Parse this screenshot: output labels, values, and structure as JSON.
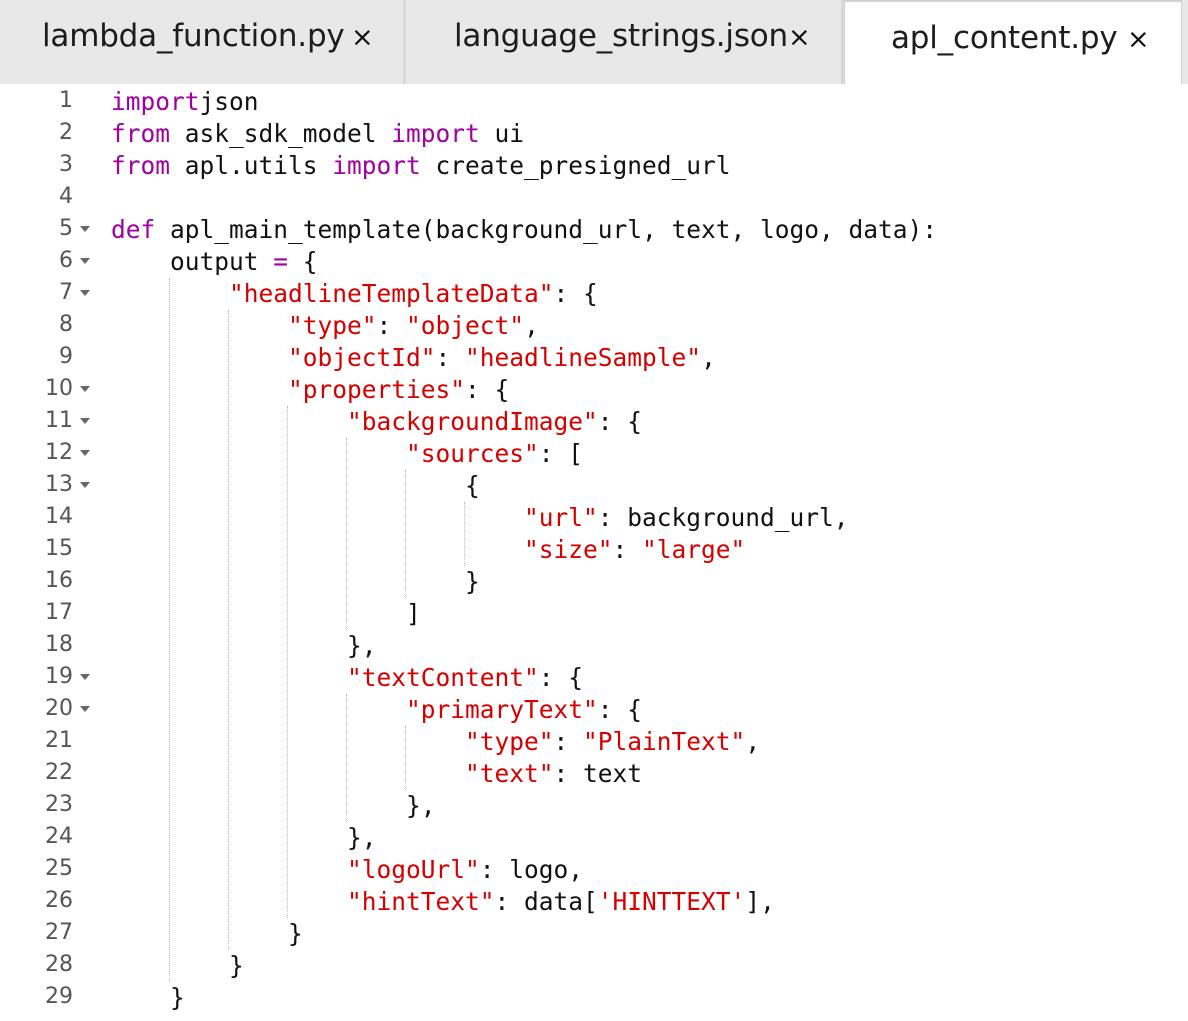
{
  "tabs": [
    {
      "label": "lambda_function.py",
      "active": false
    },
    {
      "label": "language_strings.json",
      "active": false
    },
    {
      "label": "apl_content.py",
      "active": true
    }
  ],
  "close_glyph": "×",
  "colors": {
    "keyword": "#a000a0",
    "string": "#d40000",
    "text": "#111111",
    "line_number": "#555555"
  },
  "lines": [
    {
      "n": "1",
      "fold": false,
      "tokens": [
        [
          "kw",
          "import"
        ],
        [
          "",
          "json"
        ]
      ]
    },
    {
      "n": "2",
      "fold": false,
      "tokens": [
        [
          "kw",
          "from"
        ],
        [
          "",
          " ask_sdk_model "
        ],
        [
          "kw",
          "import"
        ],
        [
          "",
          " ui"
        ]
      ]
    },
    {
      "n": "3",
      "fold": false,
      "tokens": [
        [
          "kw",
          "from"
        ],
        [
          "",
          " apl.utils "
        ],
        [
          "kw",
          "import"
        ],
        [
          "",
          " create_presigned_url"
        ]
      ]
    },
    {
      "n": "4",
      "fold": false,
      "tokens": []
    },
    {
      "n": "5",
      "fold": true,
      "tokens": [
        [
          "kw",
          "def"
        ],
        [
          "",
          " apl_main_template(background_url, text, logo, data):"
        ]
      ]
    },
    {
      "n": "6",
      "fold": true,
      "tokens": [
        [
          "",
          "    output "
        ],
        [
          "kw",
          "="
        ],
        [
          "",
          " {"
        ]
      ]
    },
    {
      "n": "7",
      "fold": true,
      "tokens": [
        [
          "",
          "        "
        ],
        [
          "str",
          "\"headlineTemplateData\""
        ],
        [
          "",
          ": {"
        ]
      ]
    },
    {
      "n": "8",
      "fold": false,
      "tokens": [
        [
          "",
          "            "
        ],
        [
          "str",
          "\"type\""
        ],
        [
          "",
          ": "
        ],
        [
          "str",
          "\"object\""
        ],
        [
          "",
          ","
        ]
      ]
    },
    {
      "n": "9",
      "fold": false,
      "tokens": [
        [
          "",
          "            "
        ],
        [
          "str",
          "\"objectId\""
        ],
        [
          "",
          ": "
        ],
        [
          "str",
          "\"headlineSample\""
        ],
        [
          "",
          ","
        ]
      ]
    },
    {
      "n": "10",
      "fold": true,
      "tokens": [
        [
          "",
          "            "
        ],
        [
          "str",
          "\"properties\""
        ],
        [
          "",
          ": {"
        ]
      ]
    },
    {
      "n": "11",
      "fold": true,
      "tokens": [
        [
          "",
          "                "
        ],
        [
          "str",
          "\"backgroundImage\""
        ],
        [
          "",
          ": {"
        ]
      ]
    },
    {
      "n": "12",
      "fold": true,
      "tokens": [
        [
          "",
          "                    "
        ],
        [
          "str",
          "\"sources\""
        ],
        [
          "",
          ": ["
        ]
      ]
    },
    {
      "n": "13",
      "fold": true,
      "tokens": [
        [
          "",
          "                        {"
        ]
      ]
    },
    {
      "n": "14",
      "fold": false,
      "tokens": [
        [
          "",
          "                            "
        ],
        [
          "str",
          "\"url\""
        ],
        [
          "",
          ": background_url,"
        ]
      ]
    },
    {
      "n": "15",
      "fold": false,
      "tokens": [
        [
          "",
          "                            "
        ],
        [
          "str",
          "\"size\""
        ],
        [
          "",
          ": "
        ],
        [
          "str",
          "\"large\""
        ]
      ]
    },
    {
      "n": "16",
      "fold": false,
      "tokens": [
        [
          "",
          "                        }"
        ]
      ]
    },
    {
      "n": "17",
      "fold": false,
      "tokens": [
        [
          "",
          "                    ]"
        ]
      ]
    },
    {
      "n": "18",
      "fold": false,
      "tokens": [
        [
          "",
          "                },"
        ]
      ]
    },
    {
      "n": "19",
      "fold": true,
      "tokens": [
        [
          "",
          "                "
        ],
        [
          "str",
          "\"textContent\""
        ],
        [
          "",
          ": {"
        ]
      ]
    },
    {
      "n": "20",
      "fold": true,
      "tokens": [
        [
          "",
          "                    "
        ],
        [
          "str",
          "\"primaryText\""
        ],
        [
          "",
          ": {"
        ]
      ]
    },
    {
      "n": "21",
      "fold": false,
      "tokens": [
        [
          "",
          "                        "
        ],
        [
          "str",
          "\"type\""
        ],
        [
          "",
          ": "
        ],
        [
          "str",
          "\"PlainText\""
        ],
        [
          "",
          ","
        ]
      ]
    },
    {
      "n": "22",
      "fold": false,
      "tokens": [
        [
          "",
          "                        "
        ],
        [
          "str",
          "\"text\""
        ],
        [
          "",
          ": text"
        ]
      ]
    },
    {
      "n": "23",
      "fold": false,
      "tokens": [
        [
          "",
          "                    },"
        ]
      ]
    },
    {
      "n": "24",
      "fold": false,
      "tokens": [
        [
          "",
          "                },"
        ]
      ]
    },
    {
      "n": "25",
      "fold": false,
      "tokens": [
        [
          "",
          "                "
        ],
        [
          "str",
          "\"logoUrl\""
        ],
        [
          "",
          ": logo,"
        ]
      ]
    },
    {
      "n": "26",
      "fold": false,
      "tokens": [
        [
          "",
          "                "
        ],
        [
          "str",
          "\"hintText\""
        ],
        [
          "",
          ": data["
        ],
        [
          "str",
          "'HINTTEXT'"
        ],
        [
          "",
          "],"
        ]
      ]
    },
    {
      "n": "27",
      "fold": false,
      "tokens": [
        [
          "",
          "            }"
        ]
      ]
    },
    {
      "n": "28",
      "fold": false,
      "tokens": [
        [
          "",
          "        }"
        ]
      ]
    },
    {
      "n": "29",
      "fold": false,
      "tokens": [
        [
          "",
          "    }"
        ]
      ]
    }
  ]
}
